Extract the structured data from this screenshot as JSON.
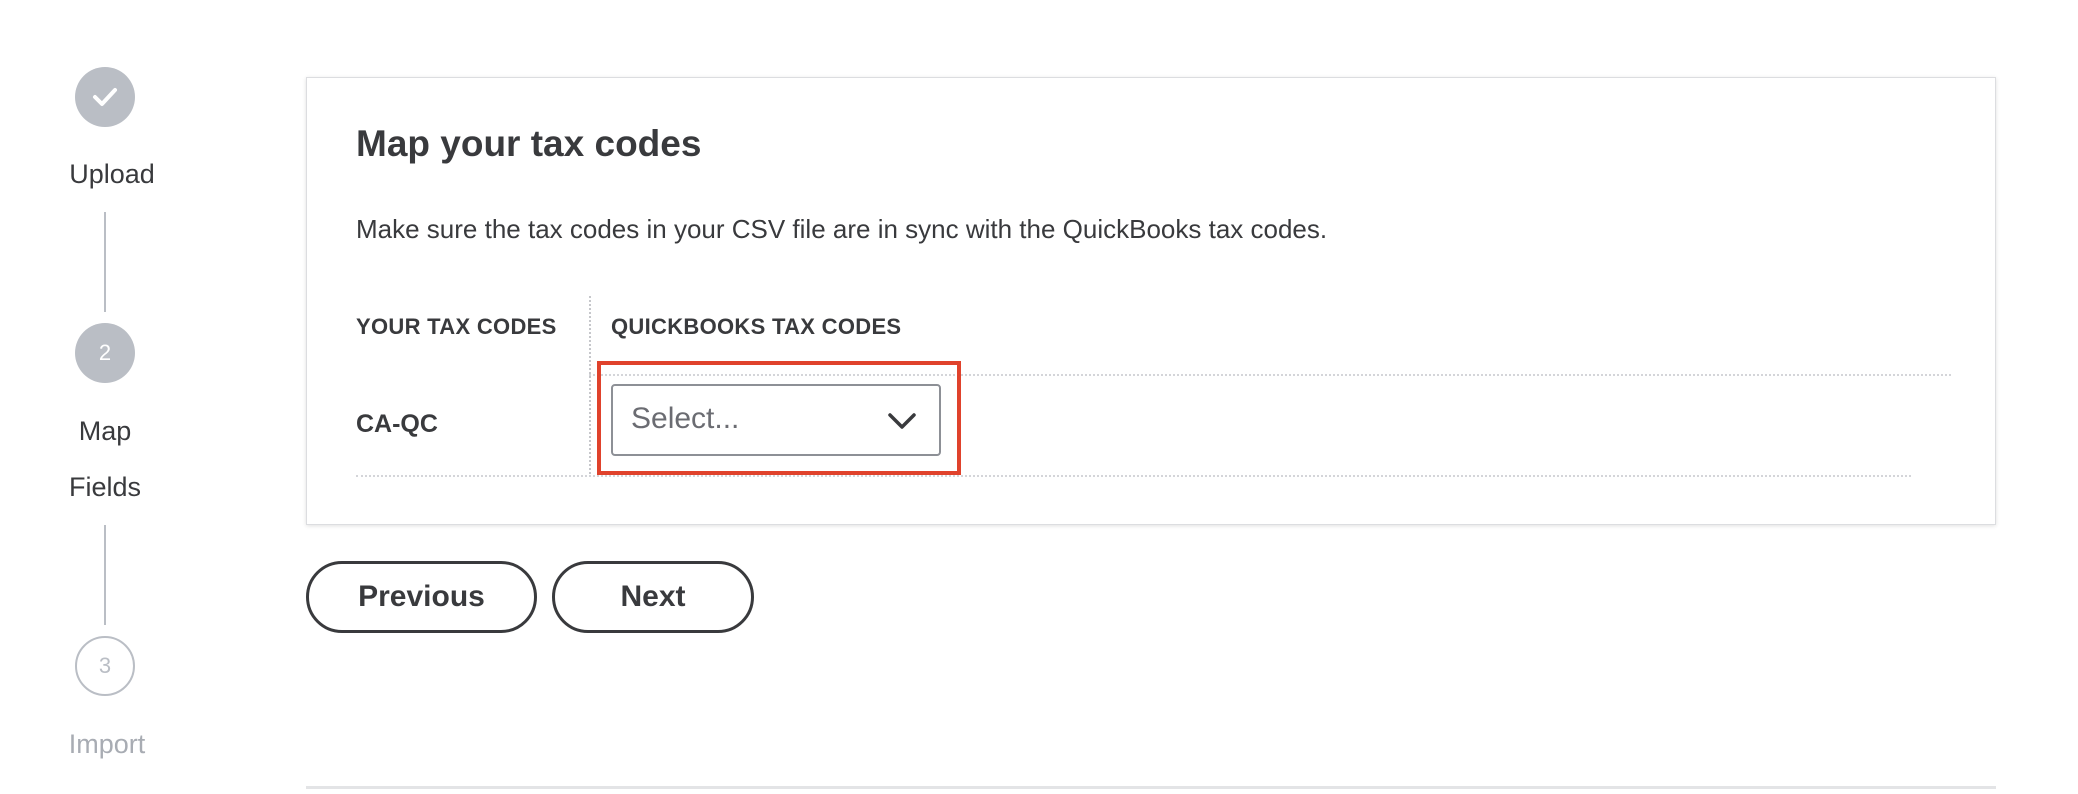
{
  "stepper": {
    "steps": [
      {
        "number": "",
        "label": "Upload",
        "state": "complete",
        "icon": "check-icon"
      },
      {
        "number": "2",
        "label": "Map\nFields",
        "state": "current"
      },
      {
        "number": "3",
        "label": "Import",
        "state": "upcoming"
      }
    ]
  },
  "card": {
    "title": "Map your tax codes",
    "description": "Make sure the tax codes in your CSV file are in sync with the QuickBooks tax codes.",
    "columns": [
      "YOUR TAX CODES",
      "QUICKBOOKS TAX CODES"
    ],
    "rows": [
      {
        "your_code": "CA-QC",
        "quickbooks_select": {
          "value": "",
          "placeholder": "Select..."
        }
      }
    ]
  },
  "buttons": {
    "previous": "Previous",
    "next": "Next"
  },
  "colors": {
    "text": "#393a3d",
    "step_gray": "#babec5",
    "highlight": "#e0422c"
  }
}
